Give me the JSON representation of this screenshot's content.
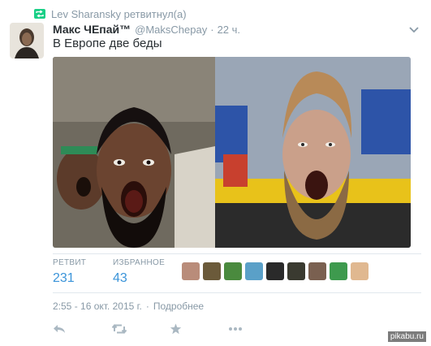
{
  "retweet": {
    "text": "Lev Sharansky ретвитнул(а)"
  },
  "tweet": {
    "author_name": "Макс ЧЕпай™",
    "author_handle": "@MaksChepay",
    "separator": "·",
    "timestamp": "22 ч.",
    "text": "В Европе две беды"
  },
  "stats": {
    "retweets_label": "РЕТВИТ",
    "retweets_value": "231",
    "favorites_label": "ИЗБРАННОЕ",
    "favorites_value": "43",
    "favoriter_avatars": 9
  },
  "meta": {
    "datetime": "2:55 - 16 окт. 2015 г.",
    "separator": "·",
    "details_link": "Подробнее"
  },
  "actions": {
    "icons": [
      "reply-icon",
      "retweet-icon",
      "favorite-icon",
      "more-icon"
    ]
  },
  "watermark": "pikabu.ru",
  "colors": {
    "link_blue": "#3b94d9",
    "muted_gray": "#8899a6",
    "text_dark": "#292f33",
    "retweet_green": "#19cf86"
  }
}
